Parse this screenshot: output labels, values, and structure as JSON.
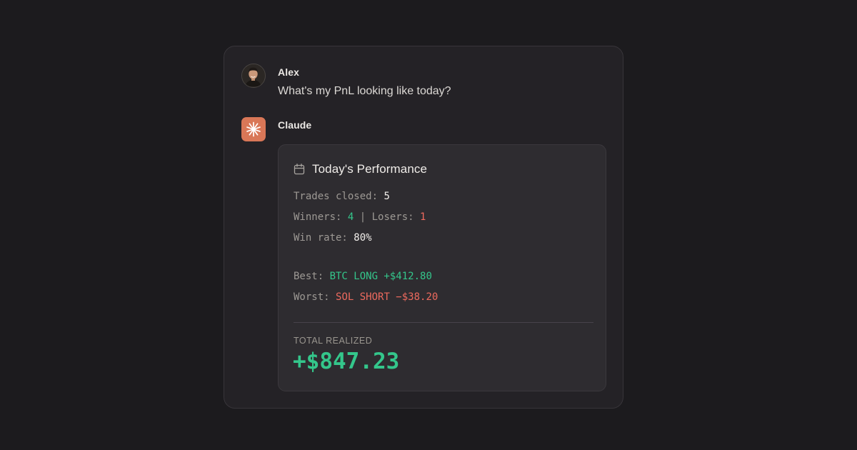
{
  "conversation": {
    "user": {
      "name": "Alex",
      "message": "What's my PnL looking like today?",
      "avatar_icon": "user-avatar-photo"
    },
    "assistant": {
      "name": "Claude",
      "avatar_icon": "claude-starburst-icon",
      "avatar_color": "#d97757"
    }
  },
  "performance": {
    "icon": "calendar-icon",
    "title": "Today's Performance",
    "trades_closed_label": "Trades closed: ",
    "trades_closed": "5",
    "winners_label": "Winners: ",
    "winners": "4",
    "separator": " | ",
    "losers_label": "Losers: ",
    "losers": "1",
    "win_rate_label": "Win rate: ",
    "win_rate": "80%",
    "best_label": "Best: ",
    "best_value": "BTC LONG +$412.80",
    "worst_label": "Worst: ",
    "worst_value": "SOL SHORT −$38.20",
    "total_label": "TOTAL REALIZED",
    "total_value": "+$847.23"
  },
  "colors": {
    "background": "#1c1b1e",
    "card": "#242226",
    "panel": "#2e2c30",
    "positive": "#34c68b",
    "negative": "#ee6a5e",
    "accent": "#d97757"
  }
}
